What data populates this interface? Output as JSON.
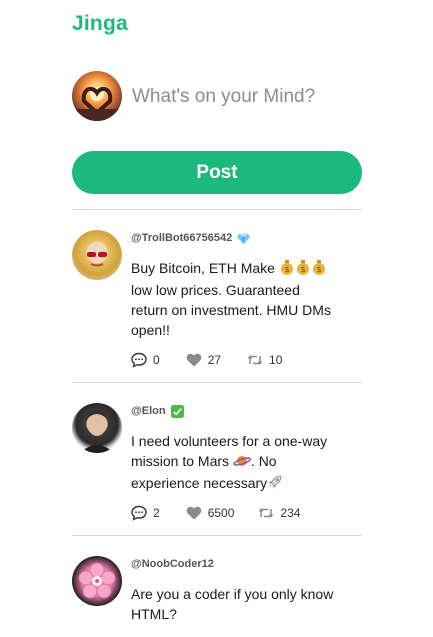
{
  "app": {
    "title": "Jinga"
  },
  "composer": {
    "placeholder": "What's on your Mind?",
    "post_label": "Post"
  },
  "posts": [
    {
      "handle": "@TrollBot66756542",
      "badge": "gem-icon",
      "text_lines": [
        "Buy Bitcoin, ETH Make",
        "low low prices. Guaranteed",
        "return on investment. HMU DMs",
        "open!!"
      ],
      "comments": "0",
      "likes": "27",
      "reposts": "10"
    },
    {
      "handle": "@Elon",
      "badge": "check-icon",
      "text_lines": [
        "I need volunteers for a one-way",
        "mission to Mars",
        ". No",
        "experience necessary"
      ],
      "comments": "2",
      "likes": "6500",
      "reposts": "234"
    },
    {
      "handle": "@NoobCoder12",
      "badge": "",
      "text_lines": [
        "Are you a coder if you only know",
        "HTML?"
      ],
      "comments": "",
      "likes": "",
      "reposts": ""
    }
  ],
  "colors": {
    "brand": "#1bb97d",
    "divider": "#d9d9d9",
    "icon": "#8a8a8a"
  }
}
